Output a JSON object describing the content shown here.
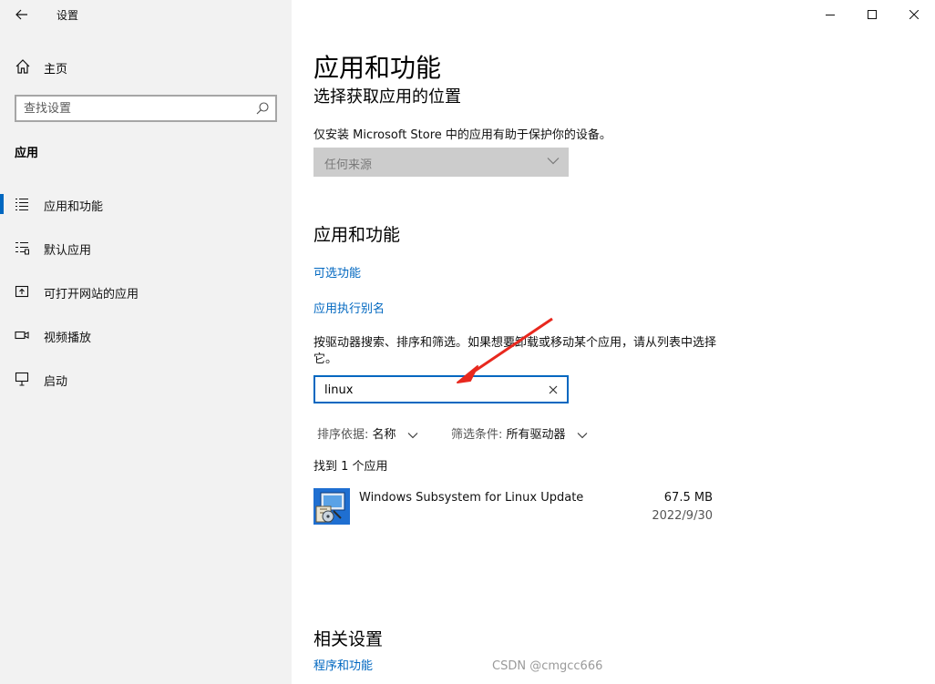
{
  "window": {
    "title": "设置",
    "back_icon": "back-arrow-icon"
  },
  "sidebar": {
    "home_label": "主页",
    "search_placeholder": "查找设置",
    "section_title": "应用",
    "items": [
      {
        "label": "应用和功能",
        "icon": "list-icon",
        "active": true
      },
      {
        "label": "默认应用",
        "icon": "default-apps-icon",
        "active": false
      },
      {
        "label": "可打开网站的应用",
        "icon": "open-website-icon",
        "active": false
      },
      {
        "label": "视频播放",
        "icon": "video-icon",
        "active": false
      },
      {
        "label": "启动",
        "icon": "startup-icon",
        "active": false
      }
    ]
  },
  "main": {
    "page_title": "应用和功能",
    "install_section": {
      "title": "选择获取应用的位置",
      "description": "仅安装 Microsoft Store 中的应用有助于保护你的设备。",
      "dropdown_value": "任何来源"
    },
    "apps_section": {
      "title": "应用和功能",
      "link_optional": "可选功能",
      "link_alias": "应用执行别名",
      "description": "按驱动器搜索、排序和筛选。如果想要卸载或移动某个应用，请从列表中选择它。",
      "search_value": "linux",
      "sort_key": "排序依据:",
      "sort_value": "名称",
      "filter_key": "筛选条件:",
      "filter_value": "所有驱动器",
      "found_text": "找到 1 个应用",
      "apps": [
        {
          "name": "Windows Subsystem for Linux Update",
          "size": "67.5 MB",
          "date": "2022/9/30"
        }
      ]
    },
    "related_section": {
      "title": "相关设置",
      "link": "程序和功能"
    }
  },
  "watermark": "CSDN @cmgcc666",
  "colors": {
    "accent": "#0067c0",
    "sidebar_bg": "#f2f2f2",
    "annotation_arrow": "#e8281e"
  }
}
